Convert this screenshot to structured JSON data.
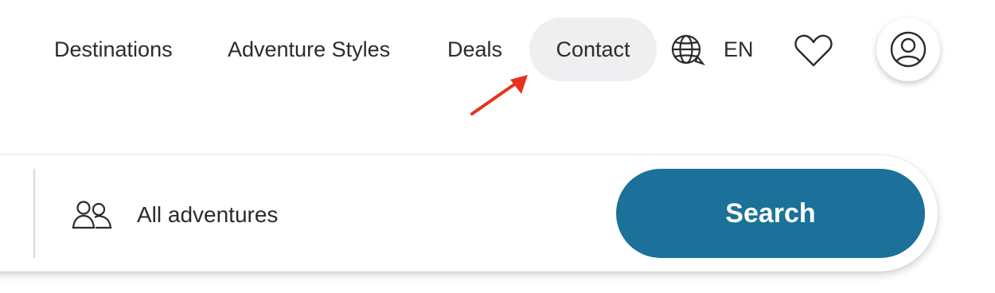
{
  "nav": {
    "items": [
      {
        "label": "Destinations"
      },
      {
        "label": "Adventure Styles"
      },
      {
        "label": "Deals"
      },
      {
        "label": "Contact"
      }
    ],
    "language": "EN",
    "icons": {
      "language": "globe-icon",
      "wishlist": "heart-icon",
      "account": "user-circle-icon"
    }
  },
  "search": {
    "travelers_label": "All adventures",
    "travelers_icon": "people-icon",
    "button_label": "Search"
  },
  "colors": {
    "search_button": "#1b7199",
    "contact_highlight": "#efeff1",
    "annotation_arrow": "#e8321e"
  }
}
